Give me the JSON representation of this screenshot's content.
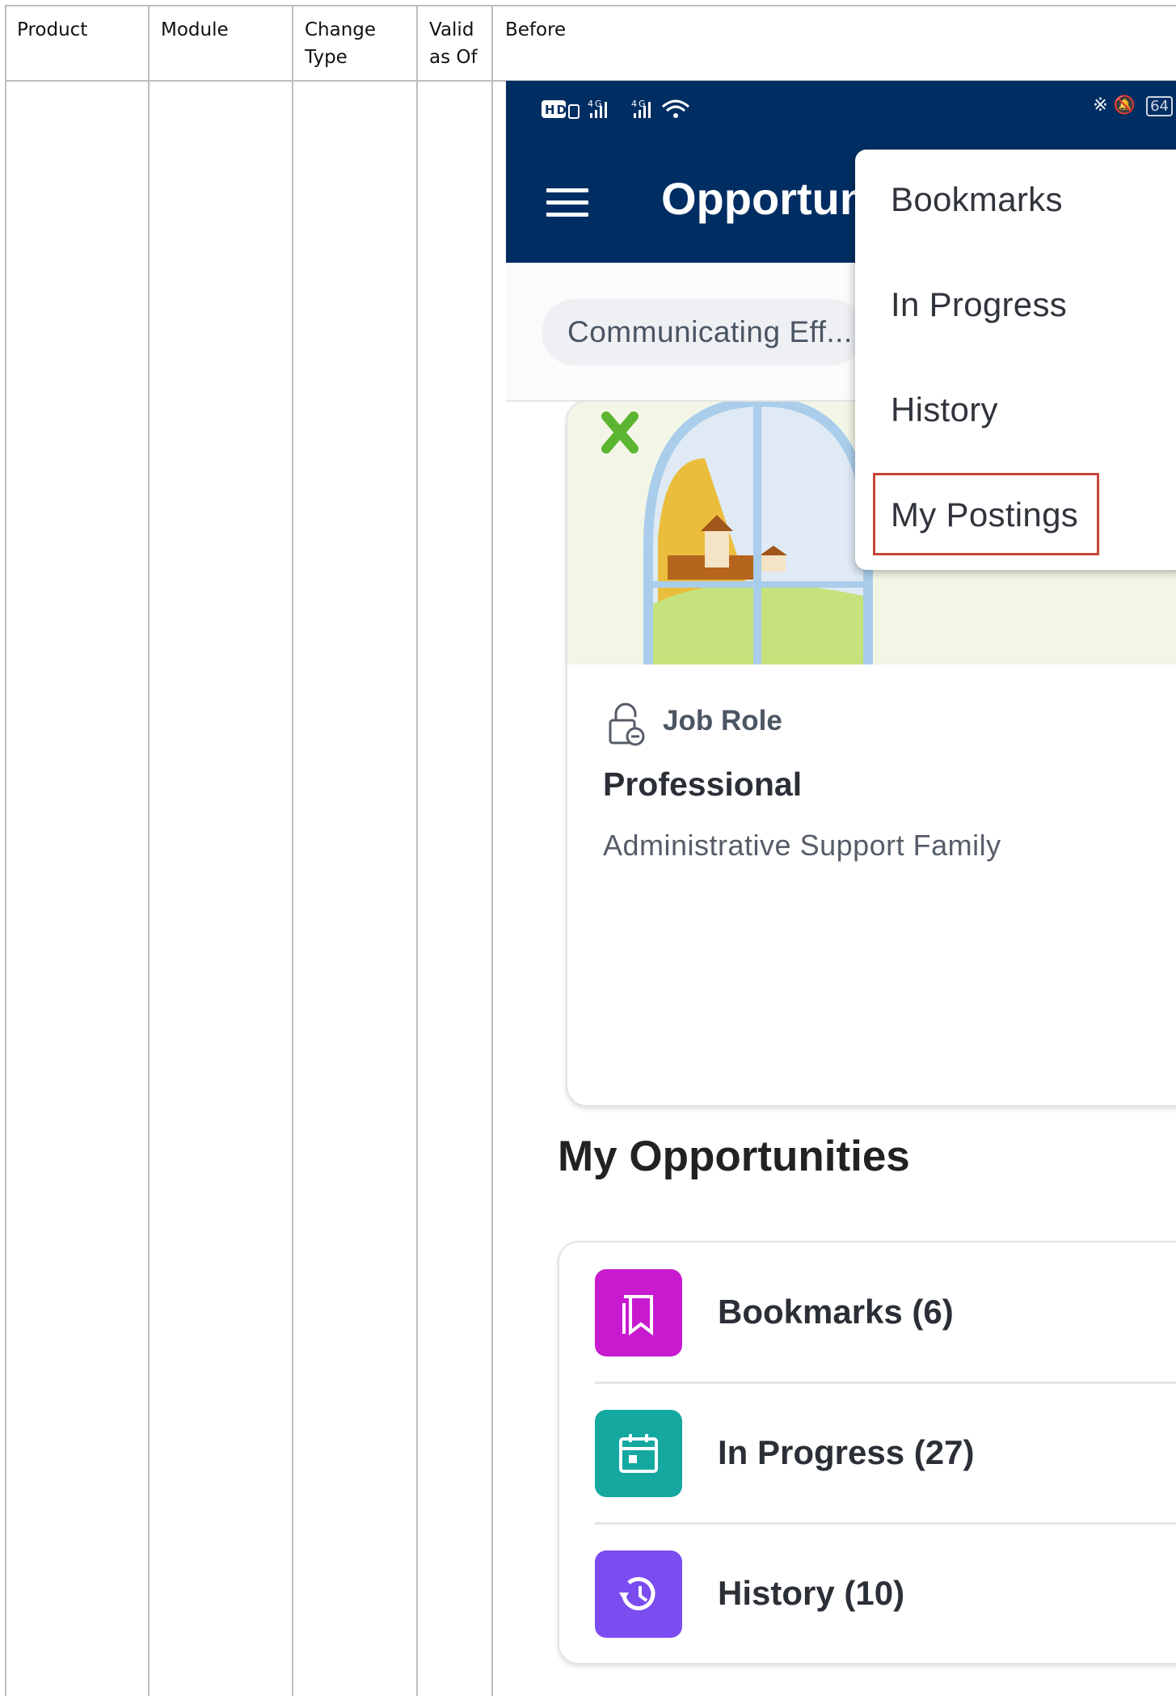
{
  "table": {
    "headers": [
      "Product",
      "Module",
      "Change\nType",
      "Valid\nas Of",
      "Before"
    ]
  },
  "phone": {
    "status_left": "HD⁰ ⁴ᴳ.ıll ⁴ᴳ.ıll",
    "battery": "64",
    "app_title": "Opportunities",
    "filter_chip": "Communicating Eff...",
    "card": {
      "eyebrow": "Job Role",
      "title": "Professional",
      "subtitle": "Administrative Support Family"
    },
    "section_title": "My Opportunities",
    "opportunities": [
      {
        "label": "Bookmarks (6)",
        "color": "#c81bd0",
        "icon": "bookmark-icon"
      },
      {
        "label": "In Progress (27)",
        "color": "#14a8a0",
        "icon": "calendar-icon"
      },
      {
        "label": "History (10)",
        "color": "#7b4cf0",
        "icon": "history-icon"
      }
    ],
    "menu": {
      "items": [
        "Bookmarks",
        "In Progress",
        "History",
        "My Postings"
      ],
      "highlighted": "My Postings",
      "highlight_color": "#c8473a"
    },
    "header_color": "#002e63"
  }
}
